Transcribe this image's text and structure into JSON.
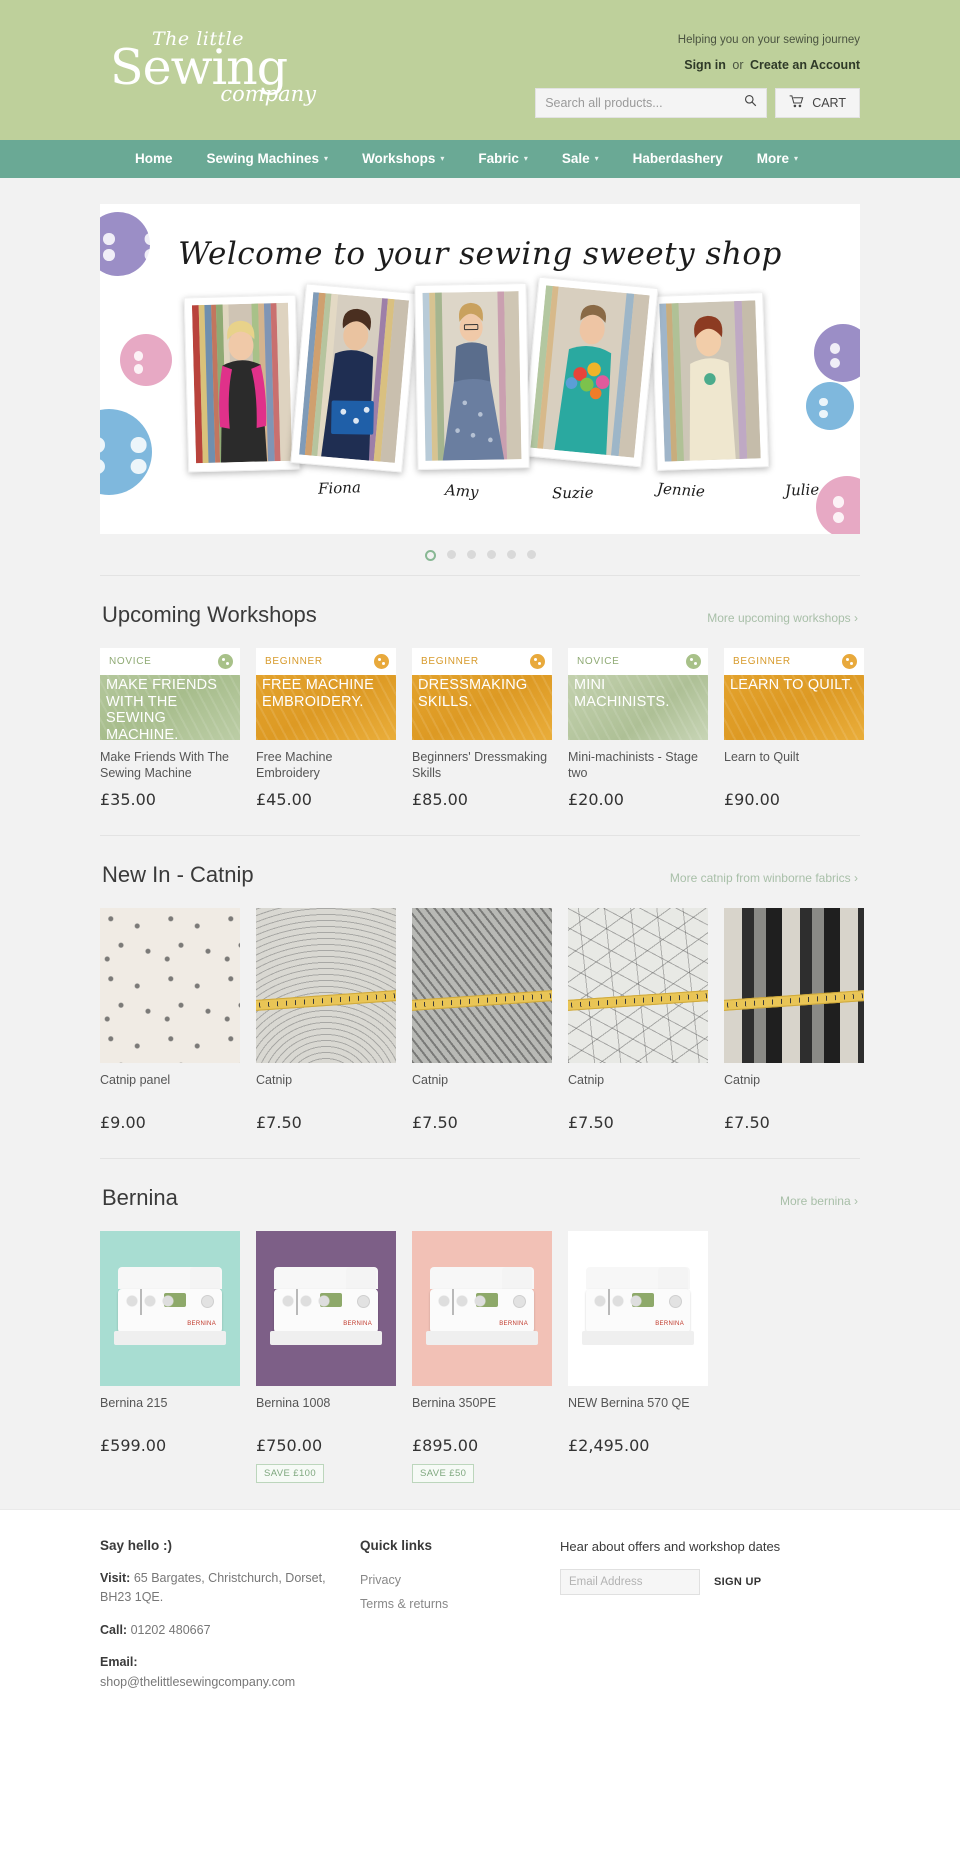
{
  "header": {
    "logo": {
      "line1": "The little",
      "line2": "Sewing",
      "line3": "company",
      "reg": "®"
    },
    "tagline": "Helping you on your sewing journey",
    "sign_in": "Sign in",
    "or": "or",
    "create_account": "Create an Account",
    "search_placeholder": "Search all products...",
    "search_value": "",
    "cart_label": "CART"
  },
  "nav": {
    "items": [
      {
        "label": "Home",
        "caret": ""
      },
      {
        "label": "Sewing Machines",
        "caret": "⌄"
      },
      {
        "label": "Workshops",
        "caret": "⌄"
      },
      {
        "label": "Fabric",
        "caret": "⌄"
      },
      {
        "label": "Sale",
        "caret": "⌄"
      },
      {
        "label": "Haberdashery",
        "caret": ""
      },
      {
        "label": "More",
        "caret": "⌄"
      }
    ]
  },
  "hero": {
    "title": "Welcome to your sewing sweety shop",
    "names": [
      "Fiona",
      "Amy",
      "Suzie",
      "Jennie",
      "Julie"
    ],
    "dots": 6,
    "active_dot": 1
  },
  "workshops": {
    "title": "Upcoming Workshops",
    "more": "More upcoming workshops ›",
    "items": [
      {
        "level": "NOVICE",
        "headline": "MAKE FRIENDS WITH THE SEWING MACHINE.",
        "title": "Make Friends With The Sewing Machine",
        "price": "£35.00"
      },
      {
        "level": "BEGINNER",
        "headline": "FREE MACHINE EMBROIDERY.",
        "title": "Free Machine Embroidery",
        "price": "£45.00"
      },
      {
        "level": "BEGINNER",
        "headline": "DRESSMAKING SKILLS.",
        "title": "Beginners' Dressmaking Skills",
        "price": "£85.00"
      },
      {
        "level": "NOVICE",
        "headline": "MINI MACHINISTS.",
        "title": "Mini-machinists - Stage two",
        "price": "£20.00"
      },
      {
        "level": "BEGINNER",
        "headline": "LEARN TO QUILT.",
        "title": "Learn to Quilt",
        "price": "£90.00"
      }
    ]
  },
  "catnip": {
    "title": "New In - Catnip",
    "more": "More catnip from winborne fabrics ›",
    "items": [
      {
        "title": "Catnip panel",
        "price": "£9.00"
      },
      {
        "title": "Catnip",
        "price": "£7.50"
      },
      {
        "title": "Catnip",
        "price": "£7.50"
      },
      {
        "title": "Catnip",
        "price": "£7.50"
      },
      {
        "title": "Catnip",
        "price": "£7.50"
      }
    ]
  },
  "bernina": {
    "title": "Bernina",
    "more": "More bernina ›",
    "items": [
      {
        "title": "Bernina 215",
        "price": "£599.00",
        "save": ""
      },
      {
        "title": "Bernina 1008",
        "price": "£750.00",
        "save": "SAVE £100"
      },
      {
        "title": "Bernina 350PE",
        "price": "£895.00",
        "save": "SAVE £50"
      },
      {
        "title": "NEW Bernina 570 QE",
        "price": "£2,495.00",
        "save": ""
      }
    ]
  },
  "footer": {
    "say_hello": "Say hello :)",
    "visit_label": "Visit:",
    "visit_value": "65 Bargates, Christchurch, Dorset, BH23 1QE.",
    "call_label": "Call:",
    "call_value": "01202 480667",
    "email_label": "Email:",
    "email_value": "shop@thelittlesewingcompany.com",
    "quick_links_title": "Quick links",
    "quick_links": [
      "Privacy",
      "Terms & returns"
    ],
    "newsletter_title": "Hear about offers and workshop dates",
    "email_placeholder": "Email Address",
    "email_value_input": "",
    "signup_label": "SIGN UP"
  },
  "colors": {
    "header_bg": "#bed09b",
    "nav_bg": "#6aa995",
    "page_bg": "#f2f2f2",
    "novice": "#8faa74",
    "beginner": "#d79a2b",
    "accent_link": "#a8bfa8"
  }
}
